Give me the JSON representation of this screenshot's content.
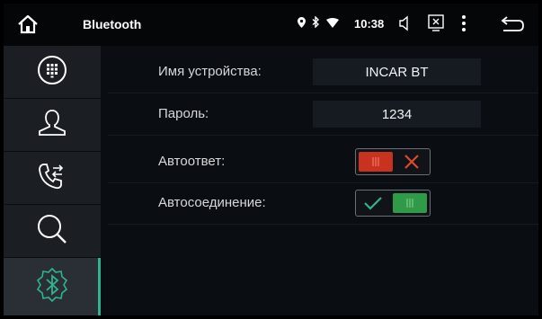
{
  "header": {
    "title": "Bluetooth",
    "time": "10:38",
    "icons": [
      "home-icon",
      "location-icon",
      "bluetooth-icon",
      "wifi-icon",
      "volume-icon",
      "screen-off-icon",
      "menu-dots-icon",
      "back-icon"
    ]
  },
  "sidebar": {
    "items": [
      {
        "icon": "dialpad-icon",
        "active": false
      },
      {
        "icon": "contacts-icon",
        "active": false
      },
      {
        "icon": "call-history-icon",
        "active": false
      },
      {
        "icon": "search-icon",
        "active": false
      },
      {
        "icon": "bluetooth-settings-icon",
        "active": true
      }
    ],
    "accent_color": "#2fb58e"
  },
  "settings": {
    "device_name_label": "Имя устройства:",
    "device_name_value": "INCAR BT",
    "password_label": "Пароль:",
    "password_value": "1234",
    "auto_answer_label": "Автоответ:",
    "auto_answer_state": "off",
    "auto_connect_label": "Автосоединение:",
    "auto_connect_state": "on"
  },
  "colors": {
    "toggle_off": "#c8321f",
    "toggle_on": "#2f9a48",
    "cross": "#e0472f",
    "check": "#2fb58e"
  }
}
